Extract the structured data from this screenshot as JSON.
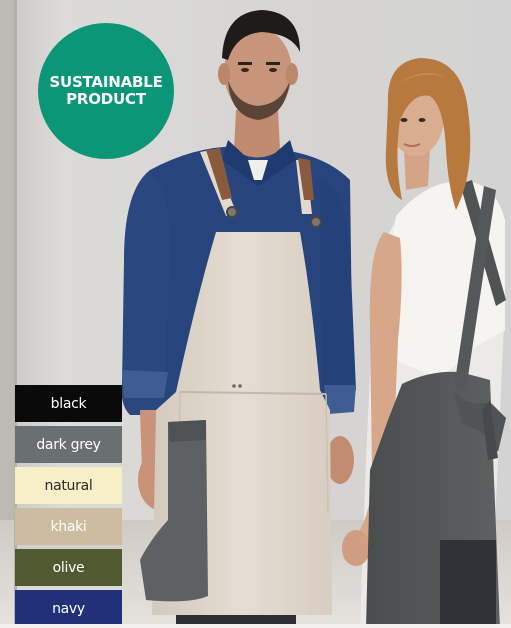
{
  "badge": {
    "line1": "SUSTAINABLE",
    "line2": "PRODUCT",
    "color": "#0b9678"
  },
  "swatches": [
    {
      "label": "black",
      "bg": "#0a0a0b",
      "fg": "#ffffff"
    },
    {
      "label": "dark grey",
      "bg": "#6a6f72",
      "fg": "#ffffff"
    },
    {
      "label": "natural",
      "bg": "#f6efc7",
      "fg": "#2a2a2a"
    },
    {
      "label": "khaki",
      "bg": "#cdbda0",
      "fg": "#ffffff"
    },
    {
      "label": "olive",
      "bg": "#4f5a31",
      "fg": "#ffffff"
    },
    {
      "label": "navy",
      "bg": "#222f79",
      "fg": "#ffffff"
    }
  ],
  "scene": {
    "wall": "#d9d8d7",
    "shirt": "#28447d",
    "apron_natural": "#e3dad0",
    "apron_grey": "#555959",
    "hair_blonde": "#bb8047",
    "skin": "#c7977a"
  }
}
